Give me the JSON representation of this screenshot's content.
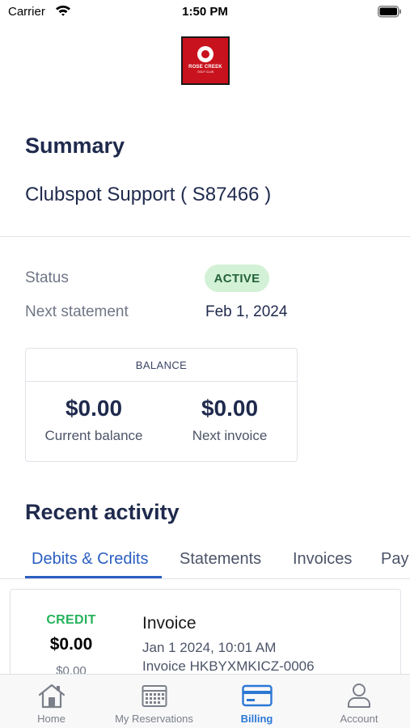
{
  "status_bar": {
    "carrier": "Carrier",
    "time": "1:50 PM"
  },
  "logo": {
    "name": "ROSE CREEK",
    "sub": "GOLF CLUB"
  },
  "summary": {
    "title": "Summary",
    "member": "Clubspot Support ( S87466 )",
    "status_label": "Status",
    "status_value": "ACTIVE",
    "next_statement_label": "Next statement",
    "next_statement_value": "Feb 1, 2024"
  },
  "balance": {
    "header": "BALANCE",
    "current_amount": "$0.00",
    "current_label": "Current balance",
    "next_amount": "$0.00",
    "next_label": "Next invoice"
  },
  "recent_activity": {
    "title": "Recent activity",
    "tabs": [
      {
        "label": "Debits & Credits",
        "active": true
      },
      {
        "label": "Statements",
        "active": false
      },
      {
        "label": "Invoices",
        "active": false
      },
      {
        "label": "Pay",
        "active": false
      }
    ],
    "items": [
      {
        "type": "CREDIT",
        "amount": "$0.00",
        "sub_amount": "$0.00",
        "title": "Invoice",
        "date": "Jan 1 2024, 10:01 AM",
        "reference": "Invoice HKBYXMKICZ-0006"
      }
    ]
  },
  "tabbar": {
    "items": [
      {
        "label": "Home",
        "icon": "home-icon",
        "active": false
      },
      {
        "label": "My Reservations",
        "icon": "calendar-icon",
        "active": false
      },
      {
        "label": "Billing",
        "icon": "credit-card-icon",
        "active": true
      },
      {
        "label": "Account",
        "icon": "person-icon",
        "active": false
      }
    ]
  },
  "colors": {
    "primary_text": "#1f2a4d",
    "accent": "#2b5fc0",
    "tab_active": "#2b78d4",
    "credit": "#26b25c",
    "badge_bg": "#d3f1d6",
    "logo_red": "#c8121d"
  }
}
